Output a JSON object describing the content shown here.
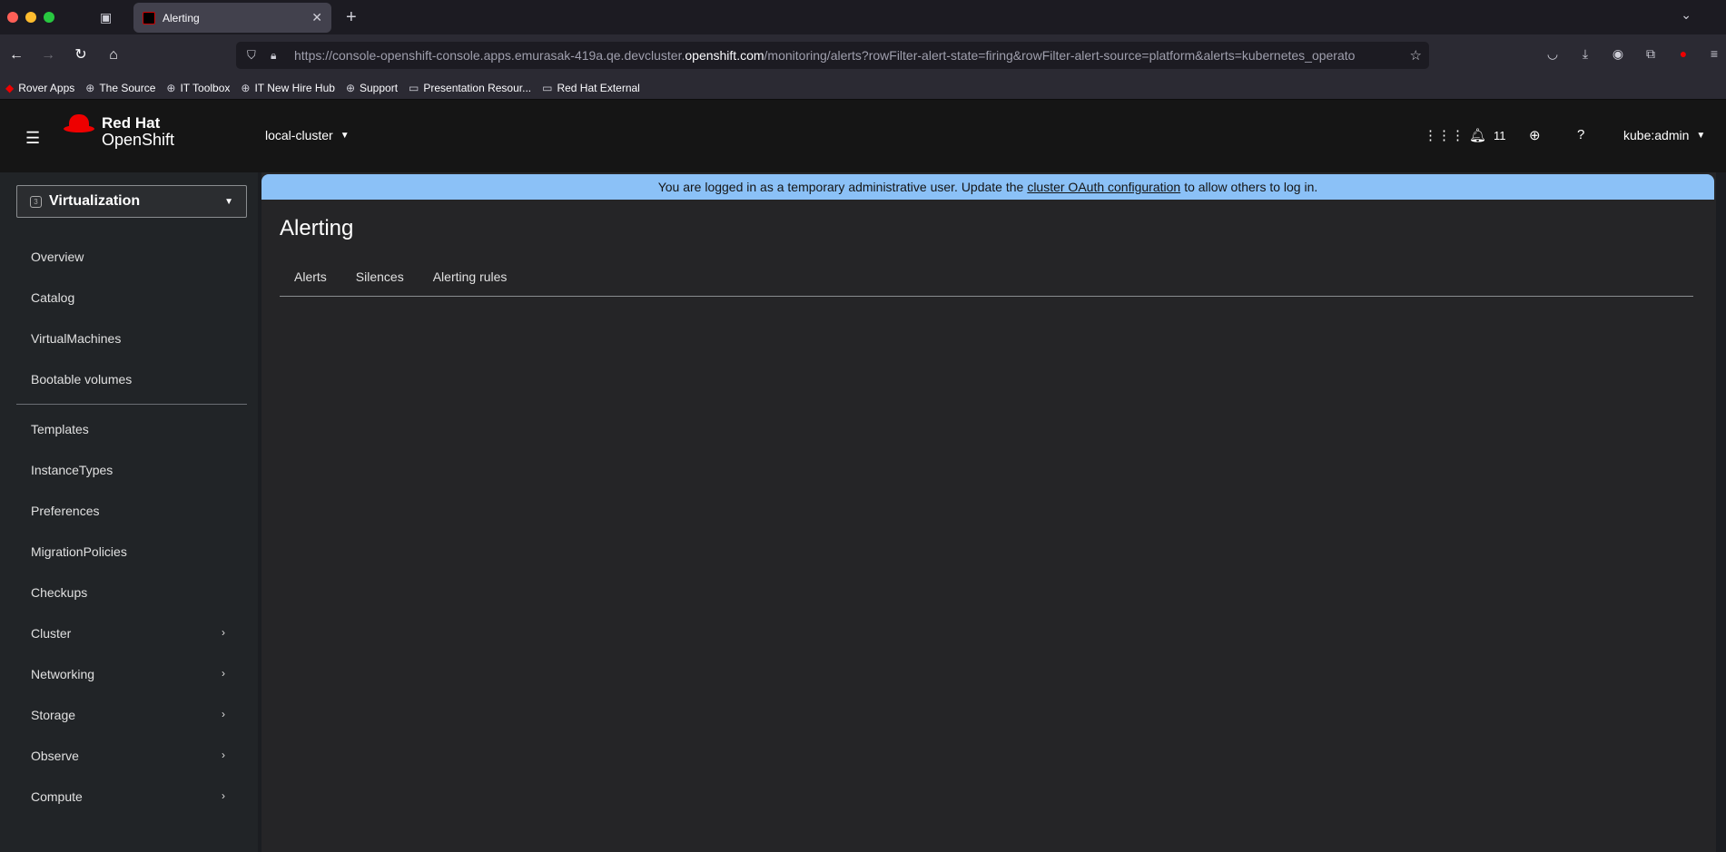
{
  "browser": {
    "tab_title": "Alerting",
    "url_prefix": "https://console-openshift-console.apps.emurasak-419a.qe.devcluster.",
    "url_domain": "openshift.com",
    "url_suffix": "/monitoring/alerts?rowFilter-alert-state=firing&rowFilter-alert-source=platform&alerts=kubernetes_operato",
    "bookmarks": [
      "Rover Apps",
      "The Source",
      "IT Toolbox",
      "IT New Hire Hub",
      "Support",
      "Presentation Resour...",
      "Red Hat External"
    ]
  },
  "masthead": {
    "logo_line1": "Red Hat",
    "logo_line2": "OpenShift",
    "cluster": "local-cluster",
    "notification_count": "11",
    "user": "kube:admin"
  },
  "sidebar": {
    "perspective": "Virtualization",
    "group1": [
      "Overview",
      "Catalog",
      "VirtualMachines",
      "Bootable volumes"
    ],
    "group2": [
      "Templates",
      "InstanceTypes",
      "Preferences",
      "MigrationPolicies",
      "Checkups"
    ],
    "expandable": [
      "Cluster",
      "Networking",
      "Storage",
      "Observe",
      "Compute"
    ]
  },
  "banner": {
    "text_before": "You are logged in as a temporary administrative user. Update the",
    "link": "cluster OAuth configuration",
    "text_after": "to allow others to log in."
  },
  "page": {
    "title": "Alerting",
    "tabs": [
      "Alerts",
      "Silences",
      "Alerting rules"
    ]
  }
}
